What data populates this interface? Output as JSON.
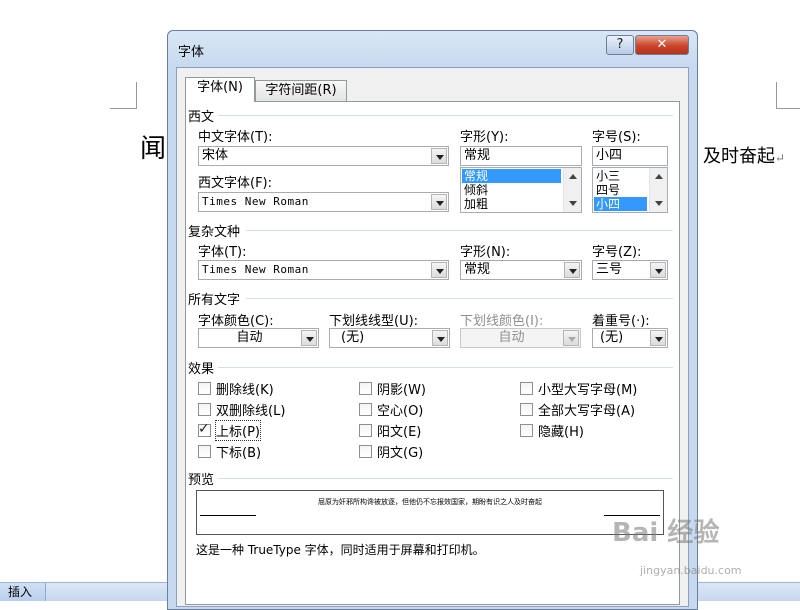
{
  "document": {
    "left_text": "闻",
    "right_text": "及时奋起",
    "return_mark": "↵"
  },
  "statusbar": {
    "insert_label": "插入"
  },
  "dialog": {
    "title": "字体",
    "help_glyph": "?",
    "close_glyph": "✕",
    "tabs": [
      "字体(N)",
      "字符间距(R)"
    ],
    "western": {
      "section": "西文",
      "chinese_font_label": "中文字体(T):",
      "chinese_font_value": "宋体",
      "western_font_label": "西文字体(F):",
      "western_font_value": "Times New Roman",
      "style_label": "字形(Y):",
      "style_value": "常规",
      "style_options": [
        "常规",
        "倾斜",
        "加粗"
      ],
      "size_label": "字号(S):",
      "size_value": "小四",
      "size_options": [
        "小三",
        "四号",
        "小四"
      ]
    },
    "complex": {
      "section": "复杂文种",
      "font_label": "字体(T):",
      "font_value": "Times New Roman",
      "style_label": "字形(N):",
      "style_value": "常规",
      "size_label": "字号(Z):",
      "size_value": "三号"
    },
    "all_text": {
      "section": "所有文字",
      "color_label": "字体颜色(C):",
      "color_value": "自动",
      "underline_label": "下划线线型(U):",
      "underline_value": "(无)",
      "underline_color_label": "下划线颜色(I):",
      "underline_color_value": "自动",
      "emphasis_label": "着重号(·):",
      "emphasis_value": "(无)"
    },
    "effects": {
      "section": "效果",
      "items": [
        {
          "label": "删除线(K)",
          "checked": false
        },
        {
          "label": "双删除线(L)",
          "checked": false
        },
        {
          "label": "上标(P)",
          "checked": true
        },
        {
          "label": "下标(B)",
          "checked": false
        },
        {
          "label": "阴影(W)",
          "checked": false
        },
        {
          "label": "空心(O)",
          "checked": false
        },
        {
          "label": "阳文(E)",
          "checked": false
        },
        {
          "label": "阴文(G)",
          "checked": false
        },
        {
          "label": "小型大写字母(M)",
          "checked": false
        },
        {
          "label": "全部大写字母(A)",
          "checked": false
        },
        {
          "label": "隐藏(H)",
          "checked": false
        }
      ]
    },
    "preview": {
      "section": "预览",
      "sample": "屈原为奸邪所构谗被放逐，但他仍不忘报效国家，期盼有识之人及时奋起",
      "note": "这是一种 TrueType 字体，同时适用于屏幕和打印机。"
    }
  },
  "watermark": {
    "main": "Bai 经验",
    "sub": "jingyan.baidu.com"
  }
}
